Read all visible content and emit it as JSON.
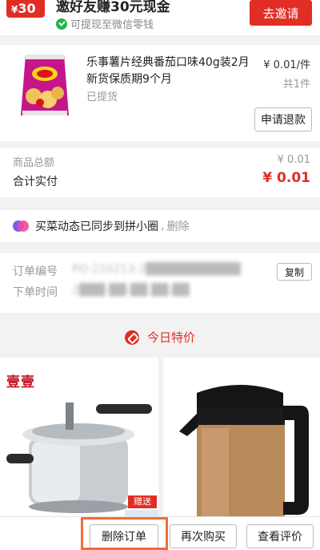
{
  "invite": {
    "coupon_amount": "30",
    "coupon_currency": "¥",
    "title": "邀好友赚30元现金",
    "subtitle": "可提现至微信零钱",
    "button": "去邀请"
  },
  "product": {
    "name": "乐事薯片经典番茄口味40g装2月新货保质期9个月",
    "status": "已提货",
    "price": "¥ 0.01/件",
    "quantity": "共1件",
    "refund_button": "申请退款"
  },
  "totals": {
    "goods_total_label": "商品总额",
    "goods_total_value": "¥ 0.01",
    "paid_label": "合计实付",
    "paid_value": "¥ 0.01"
  },
  "sync": {
    "text": "买菜动态已同步到拼小圈",
    "separator": ",",
    "delete": "删除"
  },
  "order_info": {
    "order_no_label": "订单编号",
    "order_no_value": "PO-210213-2███████████",
    "order_time_label": "下单时间",
    "order_time_value": "2███-██-██ ██:██",
    "copy_button": "复制"
  },
  "deals": {
    "title": "今日特价",
    "left_brand": "壹壹",
    "left_gift": "赠送"
  },
  "bottom_bar": {
    "delete_order": "删除订单",
    "buy_again": "再次购买",
    "view_review": "查看评价"
  },
  "colors": {
    "accent": "#e02e24",
    "highlight": "#f26b3a",
    "wechat_green": "#24b34b"
  },
  "icons": [
    "wechat-icon",
    "sync-icon",
    "tag-icon"
  ]
}
